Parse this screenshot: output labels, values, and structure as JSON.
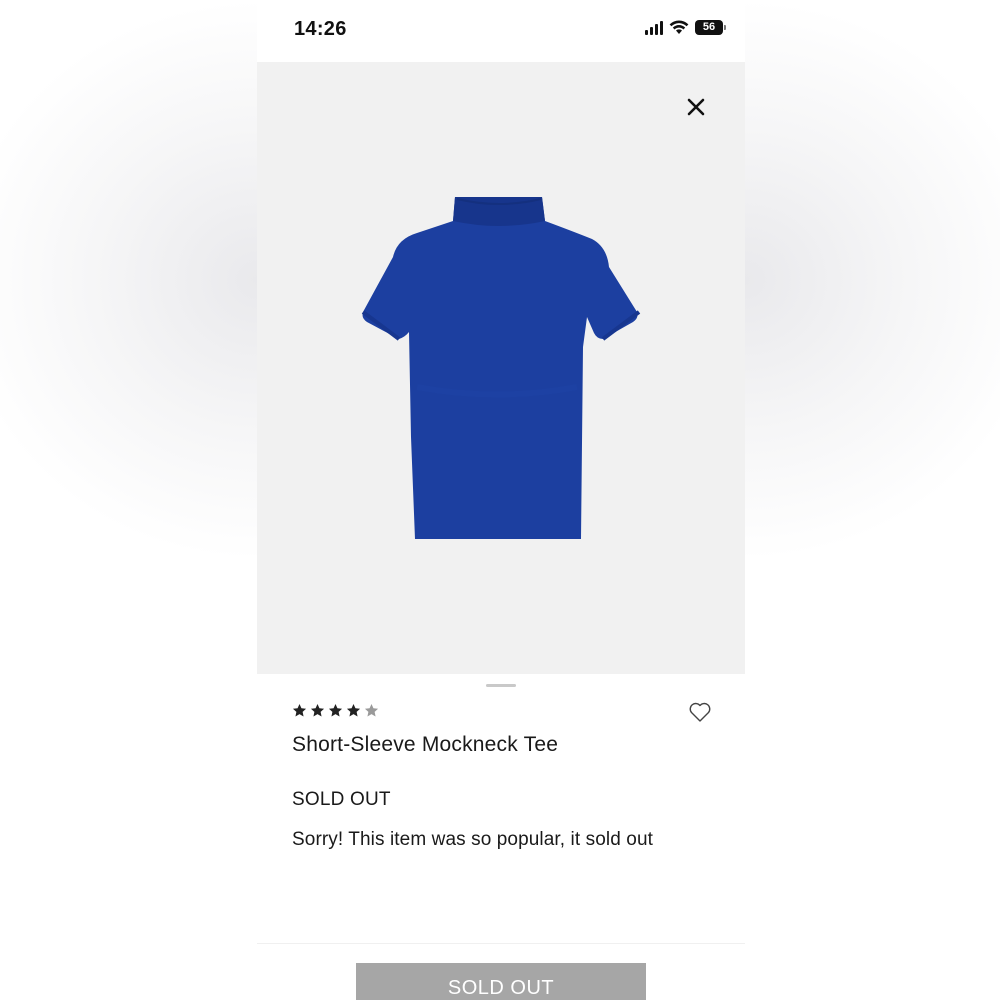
{
  "status_bar": {
    "time": "14:26",
    "battery_level": "56",
    "signal_icon": "cellular-signal-icon",
    "wifi_icon": "wifi-icon"
  },
  "product": {
    "image_icon": "blue-mockneck-tee-image",
    "image_color": "#1c3fa0",
    "rating": 4,
    "rating_max": 5,
    "title": "Short-Sleeve Mockneck Tee",
    "stock_status": "SOLD OUT",
    "stock_message": "Sorry! This item was so popular, it sold out"
  },
  "actions": {
    "close_icon": "close-icon",
    "favorite_icon": "heart-outline-icon",
    "cta_label": "SOLD OUT"
  },
  "colors": {
    "image_background": "#f1f1f1",
    "button_disabled": "#a6a6a6",
    "star_filled": "#222222",
    "star_empty": "#9a9a9a"
  }
}
